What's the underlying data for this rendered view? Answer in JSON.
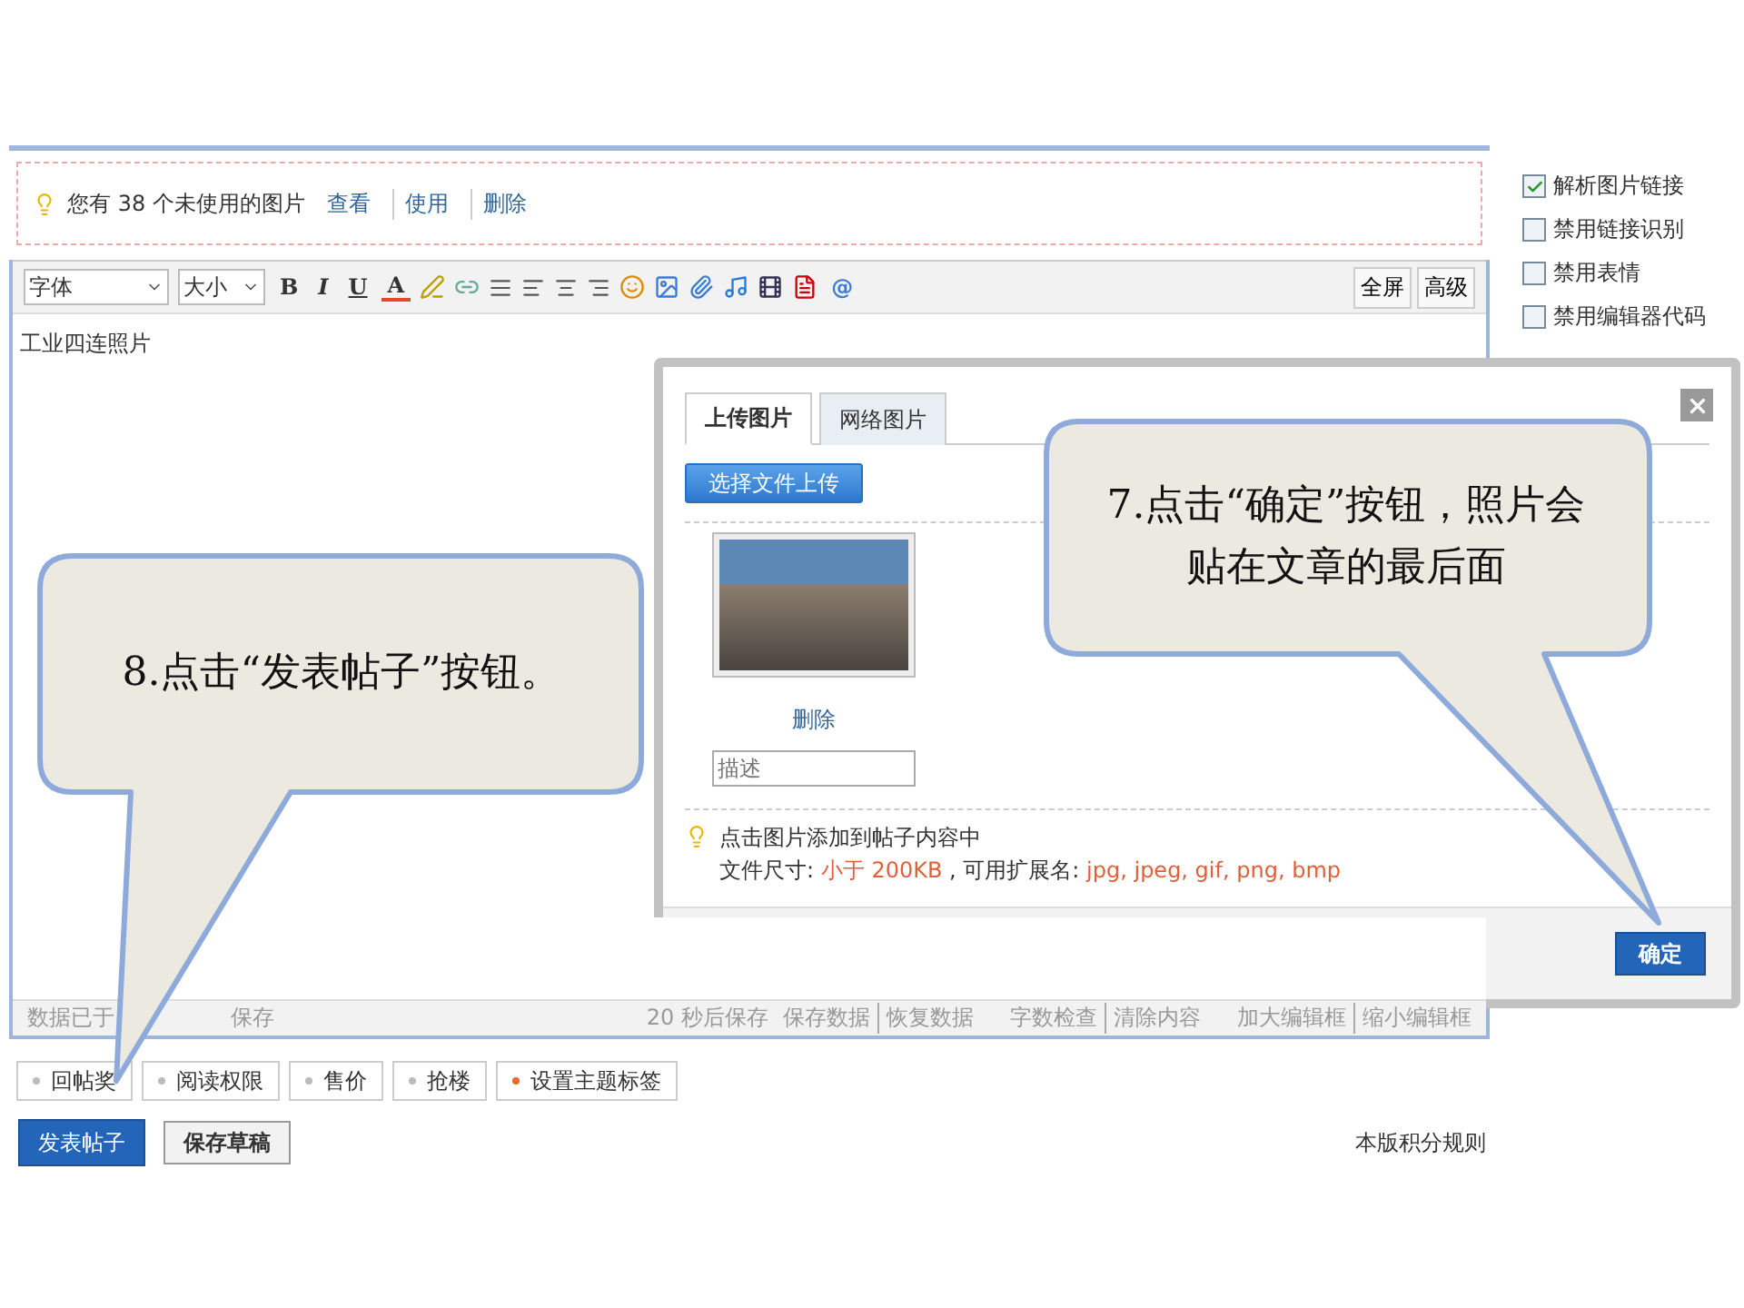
{
  "notice": {
    "text": "您有 38 个未使用的图片",
    "links": [
      "查看",
      "使用",
      "删除"
    ]
  },
  "toolbar": {
    "font_select": "字体",
    "size_select": "大小",
    "format_buttons": [
      "B",
      "I",
      "U",
      "A"
    ],
    "at_button": "@",
    "right_buttons": [
      "全屏",
      "高级"
    ]
  },
  "editor": {
    "content": "工业四连照片"
  },
  "status_bar": {
    "left": [
      "数据已于",
      "保存"
    ],
    "right": [
      "20 秒后保存",
      "保存数据",
      "恢复数据",
      "字数检查",
      "清除内容",
      "加大编辑框",
      "缩小编辑框"
    ]
  },
  "options": [
    {
      "label": "解析图片链接",
      "checked": true
    },
    {
      "label": "禁用链接识别",
      "checked": false
    },
    {
      "label": "禁用表情",
      "checked": false
    },
    {
      "label": "禁用编辑器代码",
      "checked": false
    }
  ],
  "tags": [
    {
      "label": "回帖奖",
      "highlight": false
    },
    {
      "label": "阅读权限",
      "highlight": false
    },
    {
      "label": "售价",
      "highlight": false
    },
    {
      "label": "抢楼",
      "highlight": false
    },
    {
      "label": "设置主题标签",
      "highlight": true
    }
  ],
  "actions": {
    "publish": "发表帖子",
    "save_draft": "保存草稿",
    "rules_link": "本版积分规则"
  },
  "dialog": {
    "tabs": [
      {
        "label": "上传图片",
        "selected": true
      },
      {
        "label": "网络图片",
        "selected": false
      }
    ],
    "upload_button": "选择文件上传",
    "delete_link": "删除",
    "description_placeholder": "描述",
    "tip": "点击图片添加到帖子内容中",
    "size_label": "文件尺寸:",
    "size_limit": "小于 200KB",
    "ext_label": ", 可用扩展名:",
    "extensions": "jpg, jpeg, gif, png, bmp",
    "confirm": "确定"
  },
  "callouts": [
    {
      "text": "7.点击“确定”按钮，照片会贴在文章的最后面"
    },
    {
      "text": "8.点击“发表帖子”按钮。"
    }
  ]
}
